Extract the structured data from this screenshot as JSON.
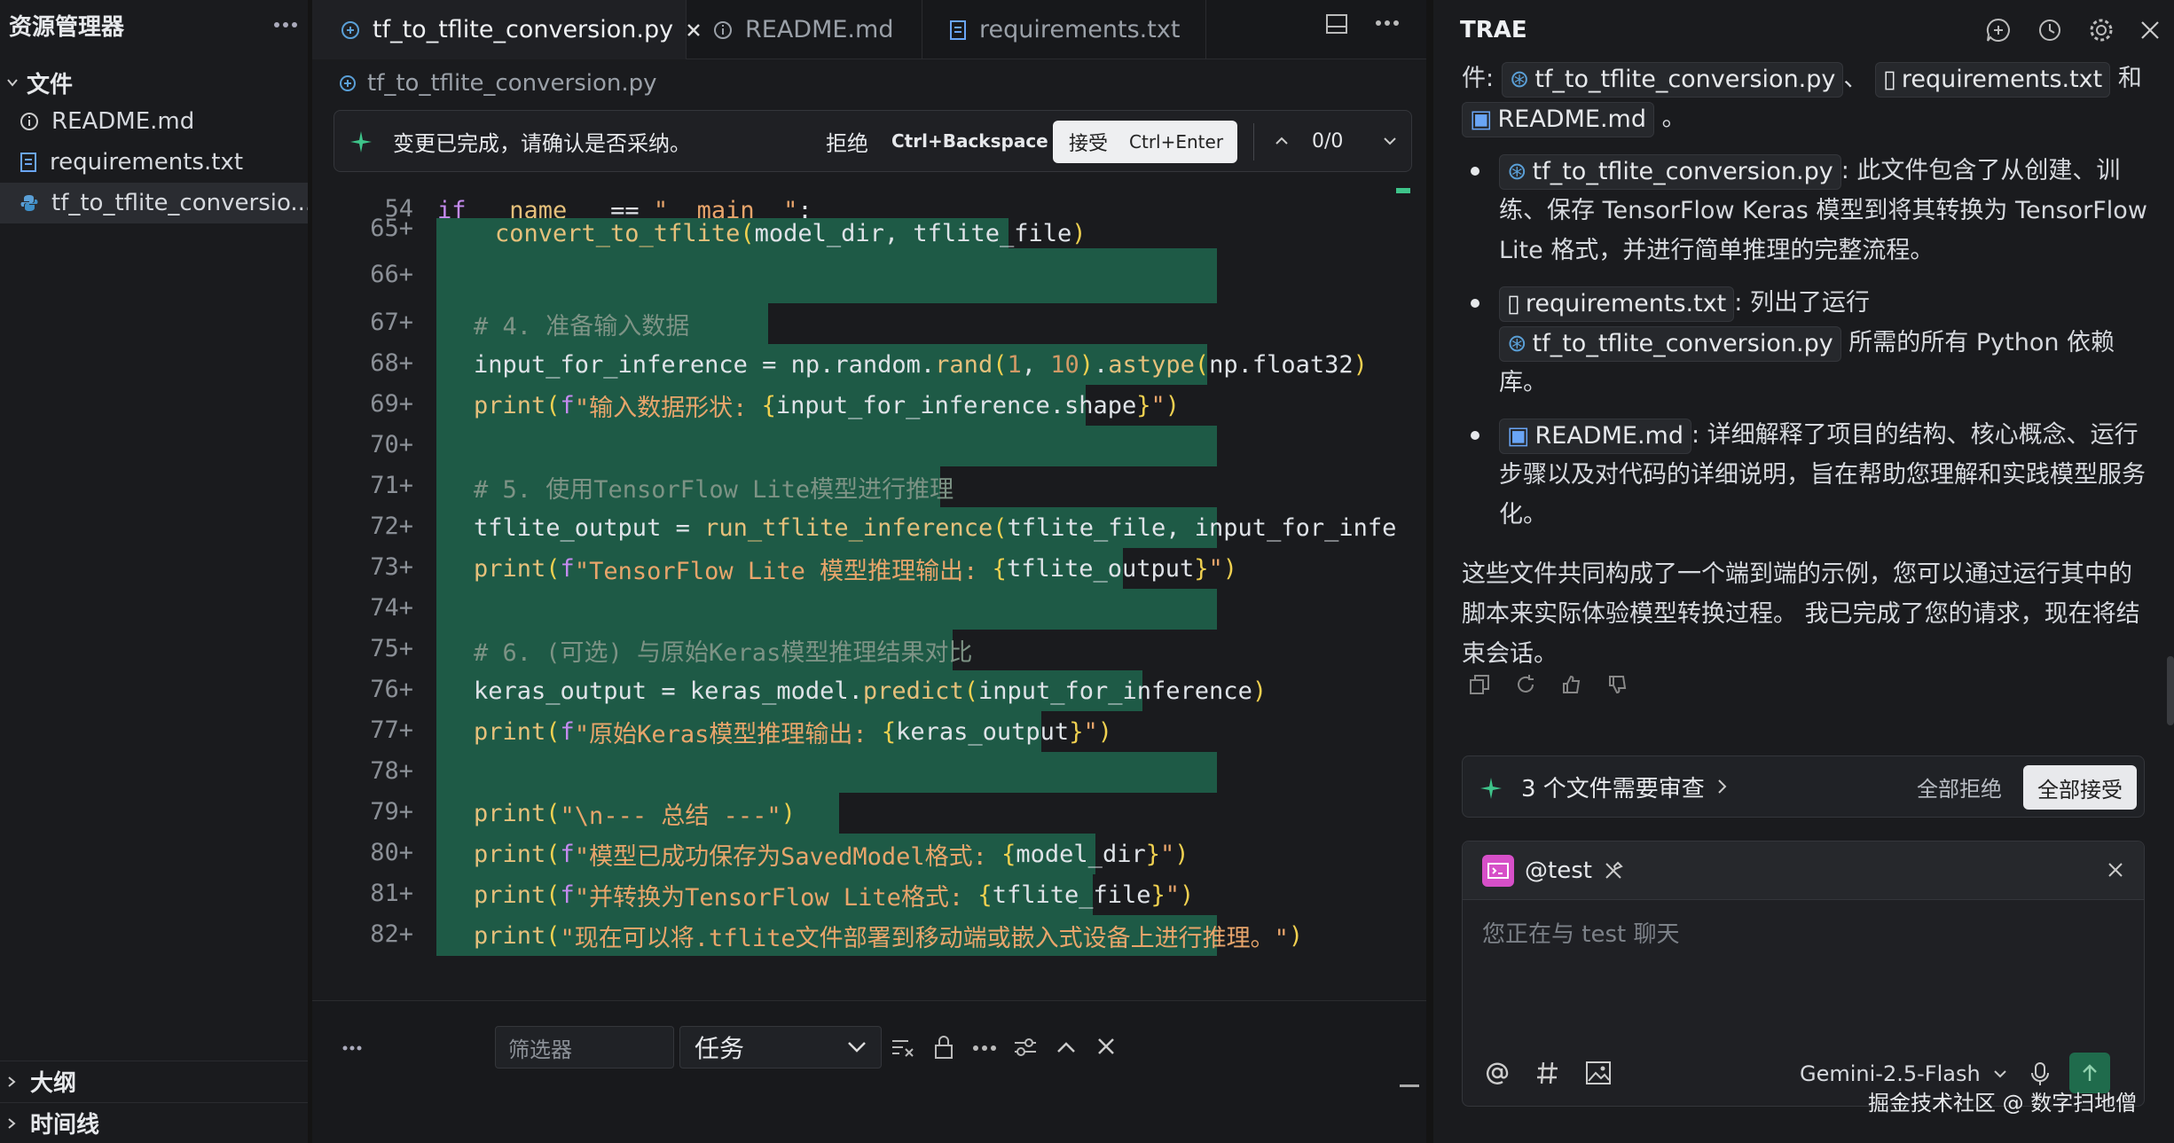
{
  "sidebar": {
    "title": "资源管理器",
    "files_section": "文件",
    "items": [
      {
        "label": "README.md",
        "icon": "info-icon"
      },
      {
        "label": "requirements.txt",
        "icon": "text-file-icon"
      },
      {
        "label": "tf_to_tflite_conversio...",
        "icon": "python-icon"
      }
    ],
    "outline": "大纲",
    "timeline": "时间线"
  },
  "tabs": [
    {
      "label": "tf_to_tflite_conversion.py",
      "icon": "python-icon"
    },
    {
      "label": "README.md",
      "icon": "info-icon"
    },
    {
      "label": "requirements.txt",
      "icon": "text-file-icon"
    }
  ],
  "breadcrumb": "tf_to_tflite_conversion.py",
  "review_bar": {
    "message": "变更已完成，请确认是否采纳。",
    "reject": "拒绝",
    "reject_shortcut": "Ctrl+Backspace",
    "accept": "接受",
    "accept_shortcut": "Ctrl+Enter",
    "counter": "0/0"
  },
  "code_lines": [
    {
      "num": "54",
      "marker": ""
    },
    {
      "num": "65",
      "marker": "+"
    },
    {
      "num": "66",
      "marker": "+"
    },
    {
      "num": "67",
      "marker": "+"
    },
    {
      "num": "68",
      "marker": "+"
    },
    {
      "num": "69",
      "marker": "+"
    },
    {
      "num": "70",
      "marker": "+"
    },
    {
      "num": "71",
      "marker": "+"
    },
    {
      "num": "72",
      "marker": "+"
    },
    {
      "num": "73",
      "marker": "+"
    },
    {
      "num": "74",
      "marker": "+"
    },
    {
      "num": "75",
      "marker": "+"
    },
    {
      "num": "76",
      "marker": "+"
    },
    {
      "num": "77",
      "marker": "+"
    },
    {
      "num": "78",
      "marker": "+"
    },
    {
      "num": "79",
      "marker": "+"
    },
    {
      "num": "80",
      "marker": "+"
    },
    {
      "num": "81",
      "marker": "+"
    },
    {
      "num": "82",
      "marker": "+"
    }
  ],
  "code": {
    "l54_if": "if ",
    "l54_name": "__name__",
    "l54_eq": " == ",
    "l54_str": "\"__main__\"",
    "l54_colon": ":",
    "l65_fn": "convert_to_tflite",
    "l65_args": "model_dir, tflite_file",
    "l67": "# 4. 准备输入数据",
    "l68_a": "input_for_inference = np.random.",
    "l68_fn": "rand",
    "l68_n1": "1",
    "l68_c": ", ",
    "l68_n2": "10",
    "l68_b": ".",
    "l68_fn2": "astype",
    "l68_arg": "np.float32",
    "l69_print": "print",
    "l69_f": "f",
    "l69_s": "\"输入数据形状: ",
    "l69_e": "input_for_inference.shape",
    "l69_end": "\"",
    "l71": "# 5. 使用TensorFlow Lite模型进行推理",
    "l72_a": "tflite_output = ",
    "l72_fn": "run_tflite_inference",
    "l72_args": "tflite_file, input_for_infe",
    "l73_print": "print",
    "l73_f": "f",
    "l73_s": "\"TensorFlow Lite 模型推理输出: ",
    "l73_e": "tflite_output",
    "l73_end": "\"",
    "l75": "# 6. (可选) 与原始Keras模型推理结果对比",
    "l76_a": "keras_output = keras_model.",
    "l76_fn": "predict",
    "l76_args": "input_for_inference",
    "l77_print": "print",
    "l77_f": "f",
    "l77_s": "\"原始Keras模型推理输出: ",
    "l77_e": "keras_output",
    "l77_end": "\"",
    "l79_print": "print",
    "l79_s": "\"\\n--- 总结 ---\"",
    "l80_print": "print",
    "l80_f": "f",
    "l80_s": "\"模型已成功保存为SavedModel格式: ",
    "l80_e": "model_dir",
    "l80_end": "\"",
    "l81_print": "print",
    "l81_f": "f",
    "l81_s": "\"并转换为TensorFlow Lite格式: ",
    "l81_e": "tflite_file",
    "l81_end": "\"",
    "l82_print": "print",
    "l82_s": "\"现在可以将.tflite文件部署到移动端或嵌入式设备上进行推理。\""
  },
  "panel": {
    "filter_placeholder": "筛选器",
    "task_select": "任务"
  },
  "chat": {
    "title": "TRAE",
    "intro_prefix": "件:",
    "files": [
      "tf_to_tflite_conversion.py",
      "requirements.txt",
      "README.md"
    ],
    "sep1": "、",
    "and": "和",
    "period": "。",
    "b1_file": "tf_to_tflite_conversion.py",
    "b1_text": ": 此文件包含了从创建、训练、保存 TensorFlow Keras 模型到将其转换为 TensorFlow Lite 格式，并进行简单推理的完整流程。",
    "b2_file": "requirements.txt",
    "b2_text": ": 列出了运行",
    "b2_file2": "tf_to_tflite_conversion.py",
    "b2_text2": "所需的所有 Python 依赖库。",
    "b3_file": "README.md",
    "b3_text": ": 详细解释了项目的结构、核心概念、运行步骤以及对代码的详细说明，旨在帮助您理解和实践模型服务化。",
    "summary": "这些文件共同构成了一个端到端的示例，您可以通过运行其中的脚本来实际体验模型转换过程。 我已完成了您的请求，现在将结束会话。",
    "review_count": "3 个文件需要审查",
    "reject_all": "全部拒绝",
    "accept_all": "全部接受",
    "agent": "@test",
    "input_placeholder": "您正在与 test 聊天",
    "model": "Gemini-2.5-Flash",
    "watermark": "掘金技术社区 @ 数字扫地僧"
  },
  "colors": {
    "added_line_bg": "#1e5a46",
    "accent": "#3ec48a"
  }
}
